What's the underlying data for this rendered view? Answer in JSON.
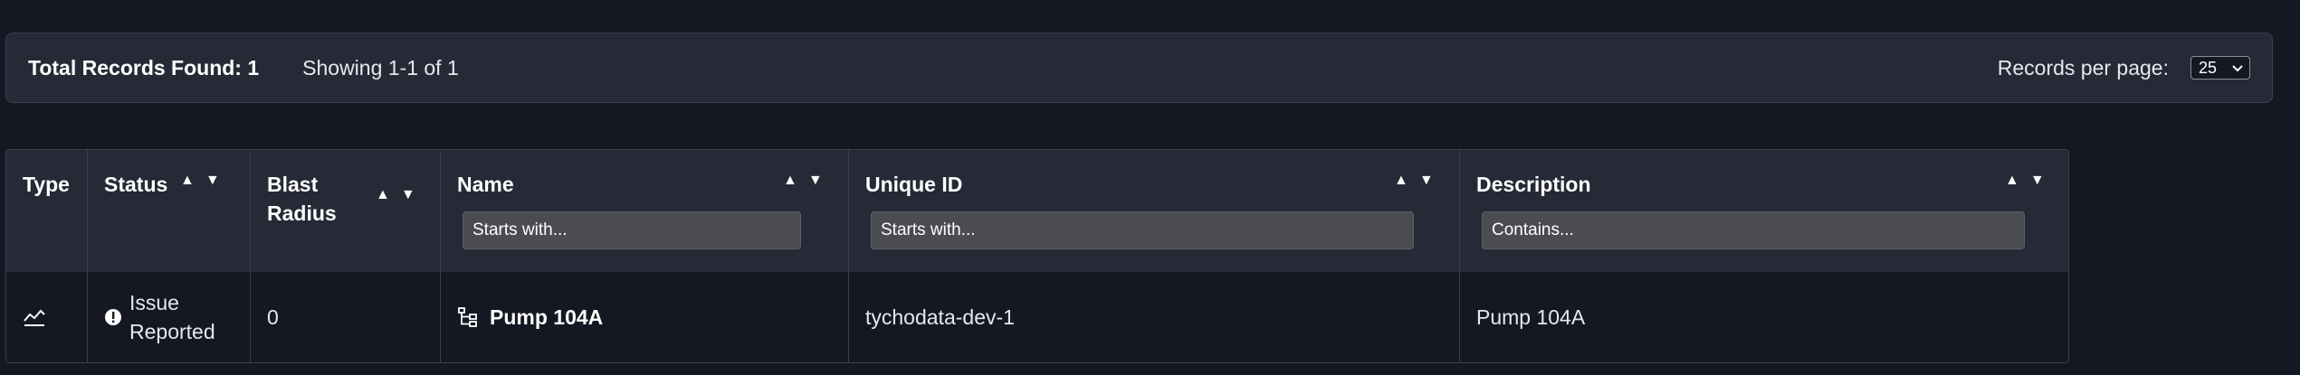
{
  "summary": {
    "total_label": "Total Records Found: 1",
    "showing": "Showing 1-1 of 1",
    "records_per_page_label": "Records per page:",
    "records_per_page_value": "25"
  },
  "table": {
    "headers": {
      "type": "Type",
      "status": "Status",
      "blast_radius_line1": "Blast",
      "blast_radius_line2": "Radius",
      "name": "Name",
      "unique_id": "Unique ID",
      "description": "Description"
    },
    "sort_up": "▲",
    "sort_down": "▼",
    "filters": {
      "name_placeholder": "Starts with...",
      "unique_id_placeholder": "Starts with...",
      "description_placeholder": "Contains..."
    },
    "rows": [
      {
        "type_icon": "trend-chart-icon",
        "status_icon": "alert-circle-icon",
        "status_line1": "Issue",
        "status_line2": "Reported",
        "blast_radius": "0",
        "name_icon": "hierarchy-icon",
        "name": "Pump 104A",
        "unique_id": "tychodata-dev-1",
        "description": "Pump 104A"
      }
    ]
  }
}
